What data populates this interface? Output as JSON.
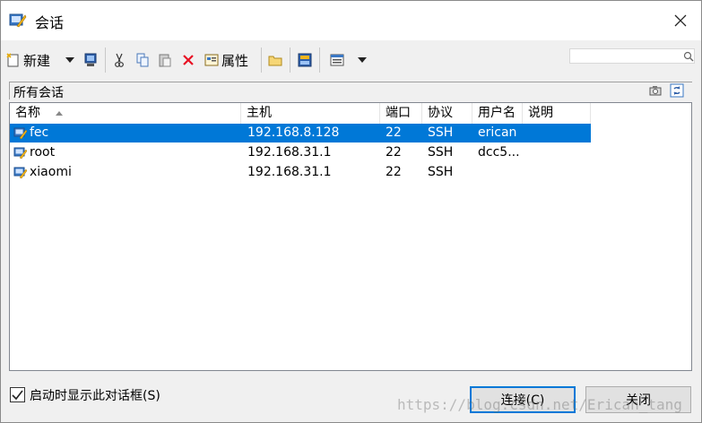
{
  "window": {
    "title": "会话"
  },
  "toolbar": {
    "new_label": "新建",
    "properties_label": "属性"
  },
  "section": {
    "label": "所有会话"
  },
  "table": {
    "columns": [
      "名称",
      "主机",
      "端口",
      "协议",
      "用户名",
      "说明"
    ],
    "rows": [
      {
        "name": "fec",
        "host": "192.168.8.128",
        "port": "22",
        "protocol": "SSH",
        "user": "erican",
        "desc": "",
        "selected": true
      },
      {
        "name": "root",
        "host": "192.168.31.1",
        "port": "22",
        "protocol": "SSH",
        "user": "dcc5...",
        "desc": "",
        "selected": false
      },
      {
        "name": "xiaomi",
        "host": "192.168.31.1",
        "port": "22",
        "protocol": "SSH",
        "user": "",
        "desc": "",
        "selected": false
      }
    ]
  },
  "footer": {
    "checkbox_label": "启动时显示此对话框(S)",
    "connect_label": "连接(C)",
    "close_label": "关闭"
  },
  "watermark": "https://blog.csdn.net/Erican_tang",
  "colors": {
    "selection": "#0078d7",
    "delete_red": "#e81123"
  }
}
